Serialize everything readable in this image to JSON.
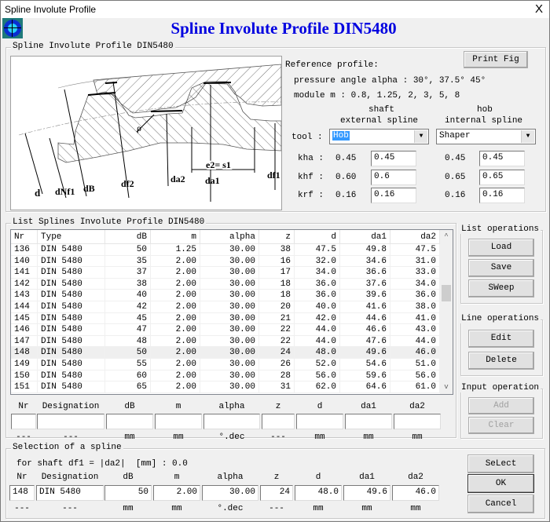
{
  "window": {
    "title": "Spline Involute Profile",
    "close_glyph": "X",
    "heading": "Spline Involute Profile DIN5480"
  },
  "profile_group": {
    "legend": "Spline Involute Profile DIN5480",
    "print_button": "Print Fig",
    "reference_label": "Reference profile:",
    "pressure_angle_text": "pressure angle alpha : 30°, 37.5° 45°",
    "module_text": "module m : 0.8, 1.25, 2, 3, 5, 8",
    "col_shaft_line1": "shaft",
    "col_shaft_line2": "external spline",
    "col_hob_line1": "hob",
    "col_hob_line2": "internal spline",
    "tool_label": "tool :",
    "shaft_tool": "Hob",
    "hob_tool": "Shaper",
    "params": [
      {
        "label": "kha :",
        "shaft_default": "0.45",
        "shaft_value": "0.45",
        "hob_default": "0.45",
        "hob_value": "0.45"
      },
      {
        "label": "khf :",
        "shaft_default": "0.60",
        "shaft_value": "0.6",
        "hob_default": "0.65",
        "hob_value": "0.65"
      },
      {
        "label": "krf :",
        "shaft_default": "0.16",
        "shaft_value": "0.16",
        "hob_default": "0.16",
        "hob_value": "0.16"
      }
    ],
    "figure_labels": {
      "d": "d",
      "dNf1": "dNf1",
      "dB": "dB",
      "df2": "df2",
      "da2": "da2",
      "da1": "da1",
      "df1": "df1",
      "e2s1": "e2= s1",
      "rho": "ρ"
    }
  },
  "list_group": {
    "legend": "List Splines Involute Profile DIN5480",
    "columns": [
      "Nr",
      "Type",
      "dB",
      "m",
      "alpha",
      "z",
      "d",
      "da1",
      "da2"
    ],
    "rows": [
      [
        "136",
        "DIN 5480",
        "50",
        "1.25",
        "30.00",
        "38",
        "47.5",
        "49.8",
        "47.5"
      ],
      [
        "140",
        "DIN 5480",
        "35",
        "2.00",
        "30.00",
        "16",
        "32.0",
        "34.6",
        "31.0"
      ],
      [
        "141",
        "DIN 5480",
        "37",
        "2.00",
        "30.00",
        "17",
        "34.0",
        "36.6",
        "33.0"
      ],
      [
        "142",
        "DIN 5480",
        "38",
        "2.00",
        "30.00",
        "18",
        "36.0",
        "37.6",
        "34.0"
      ],
      [
        "143",
        "DIN 5480",
        "40",
        "2.00",
        "30.00",
        "18",
        "36.0",
        "39.6",
        "36.0"
      ],
      [
        "144",
        "DIN 5480",
        "42",
        "2.00",
        "30.00",
        "20",
        "40.0",
        "41.6",
        "38.0"
      ],
      [
        "145",
        "DIN 5480",
        "45",
        "2.00",
        "30.00",
        "21",
        "42.0",
        "44.6",
        "41.0"
      ],
      [
        "146",
        "DIN 5480",
        "47",
        "2.00",
        "30.00",
        "22",
        "44.0",
        "46.6",
        "43.0"
      ],
      [
        "147",
        "DIN 5480",
        "48",
        "2.00",
        "30.00",
        "22",
        "44.0",
        "47.6",
        "44.0"
      ],
      [
        "148",
        "DIN 5480",
        "50",
        "2.00",
        "30.00",
        "24",
        "48.0",
        "49.6",
        "46.0"
      ],
      [
        "149",
        "DIN 5480",
        "55",
        "2.00",
        "30.00",
        "26",
        "52.0",
        "54.6",
        "51.0"
      ],
      [
        "150",
        "DIN 5480",
        "60",
        "2.00",
        "30.00",
        "28",
        "56.0",
        "59.6",
        "56.0"
      ],
      [
        "151",
        "DIN 5480",
        "65",
        "2.00",
        "30.00",
        "31",
        "62.0",
        "64.6",
        "61.0"
      ]
    ],
    "highlighted_row": "148",
    "input_headers": [
      "Nr",
      "Designation",
      "dB",
      "m",
      "alpha",
      "z",
      "d",
      "da1",
      "da2"
    ],
    "input_units": [
      "---",
      "---",
      "mm",
      "mm",
      "°.dec",
      "---",
      "mm",
      "mm",
      "mm"
    ]
  },
  "list_ops": {
    "title": "List operations",
    "load": "Load",
    "save": "Save",
    "sweep": "SWeep"
  },
  "line_ops": {
    "title": "Line operations",
    "edit": "Edit",
    "delete": "Delete"
  },
  "input_ops": {
    "title": "Input operation",
    "add": "Add",
    "clear": "Clear"
  },
  "selection_group": {
    "legend": "Selection of a spline",
    "condition": "for shaft df1 = |da2|  [mm] : 0.0",
    "headers": [
      "Nr",
      "Designation",
      "dB",
      "m",
      "alpha",
      "z",
      "d",
      "da1",
      "da2"
    ],
    "values": [
      "148",
      "DIN 5480",
      "50",
      "2.00",
      "30.00",
      "24",
      "48.0",
      "49.6",
      "46.0"
    ],
    "units": [
      "---",
      "---",
      "mm",
      "mm",
      "°.dec",
      "---",
      "mm",
      "mm",
      "mm"
    ],
    "select_button": "SeLect",
    "ok_button": "OK",
    "cancel_button": "Cancel"
  }
}
